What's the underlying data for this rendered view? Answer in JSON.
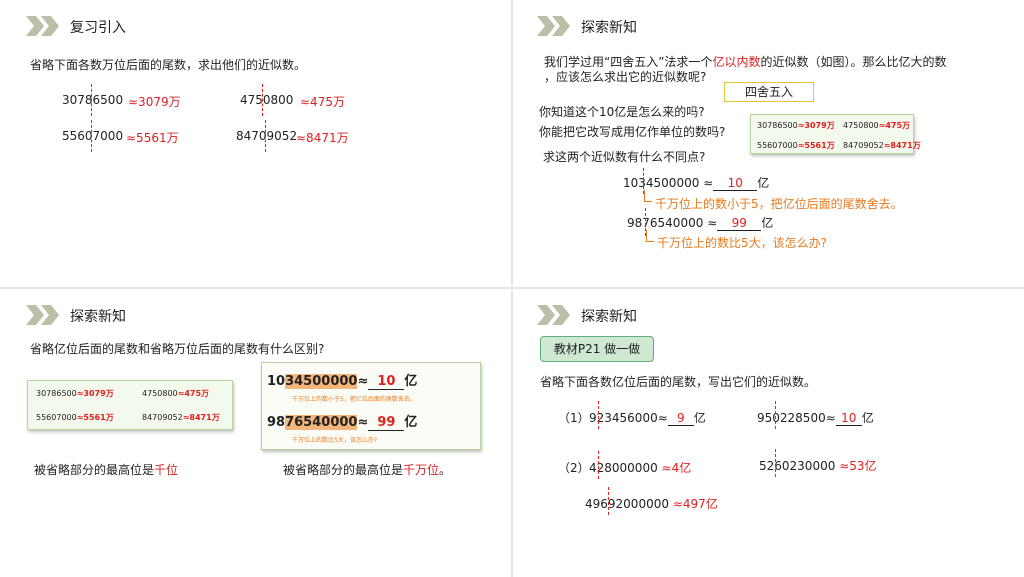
{
  "colors": {
    "accent_red": "#e02020",
    "accent_orange": "#e87a1e",
    "header_arrows": "#b9c0a6"
  },
  "panel1": {
    "title": "复习引入",
    "question": "省略下面各数万位后面的尾数，求出他们的近似数。",
    "items": [
      {
        "number": "30786500",
        "approx": "≈3079万"
      },
      {
        "number": "4750800",
        "approx": "≈475万"
      },
      {
        "number": "55607000",
        "approx": "≈5561万"
      },
      {
        "number": "84709052",
        "approx": "≈8471万"
      }
    ]
  },
  "panel2": {
    "title": "探索新知",
    "intro_pre": "我们学过用“四舍五入”法求一个",
    "intro_red": "亿以内数",
    "intro_post": "的近似数（如图）。那么比亿大的数",
    "intro_line2": "，应该怎么求出它的近似数呢?",
    "rule_box": "四舍五入",
    "q1": "你知道这个10亿是怎么来的吗?",
    "q2": "你能把它改写成用亿作单位的数吗?",
    "q3": "求这两个近似数有什么不同点?",
    "ex1_number": "1034500000",
    "ex1_sign": "≈",
    "ex1_answer": "10",
    "ex1_unit": "亿",
    "ex1_note": "千万位上的数小于5，把亿位后面的尾数舍去。",
    "ex2_number": "9876540000",
    "ex2_sign": "≈",
    "ex2_answer": "99",
    "ex2_unit": "亿",
    "ex2_note": "千万位上的数比5大，该怎么办?"
  },
  "thumb_small": {
    "items": [
      {
        "number": "30786500",
        "approx": "≈3079万"
      },
      {
        "number": "4750800",
        "approx": "≈475万"
      },
      {
        "number": "55607000",
        "approx": "≈5561万"
      },
      {
        "number": "84709052",
        "approx": "≈8471万"
      }
    ]
  },
  "panel3": {
    "title": "探索新知",
    "question": "省略亿位后面的尾数和省略万位后面的尾数有什么区别?",
    "big1_pre": "10",
    "big1_hl": "34500000",
    "big1_sign": "≈",
    "big1_answer": "10",
    "big1_unit": "亿",
    "big1_note": "千万位上的数小于5，把亿位后面的尾数舍去。",
    "big2_pre": "98",
    "big2_hl": "76540000",
    "big2_sign": "≈",
    "big2_answer": "99",
    "big2_unit": "亿",
    "big2_note": "千万位上的数比5大，该怎么办?",
    "cap1_pre": "被省略部分的最高位是",
    "cap1_red": "千位",
    "cap2_pre": "被省略部分的最高位是",
    "cap2_red": "千万位",
    "cap2_post": "。"
  },
  "panel4": {
    "title": "探索新知",
    "badge": "教材P21  做一做",
    "question": "省略下面各数亿位后面的尾数，写出它们的近似数。",
    "r1_label": "（1）",
    "r1a_number": "923456000≈",
    "r1a_answer": "9",
    "r1a_unit": "亿",
    "r1b_number": "950228500≈",
    "r1b_answer": "10",
    "r1b_unit": "亿",
    "r2_label": "（2）",
    "r2a_number": "428000000",
    "r2a_approx": "≈4亿",
    "r2b_number": "5260230000",
    "r2b_approx": "≈53亿",
    "r2c_number": "49692000000",
    "r2c_approx": "≈497亿"
  }
}
